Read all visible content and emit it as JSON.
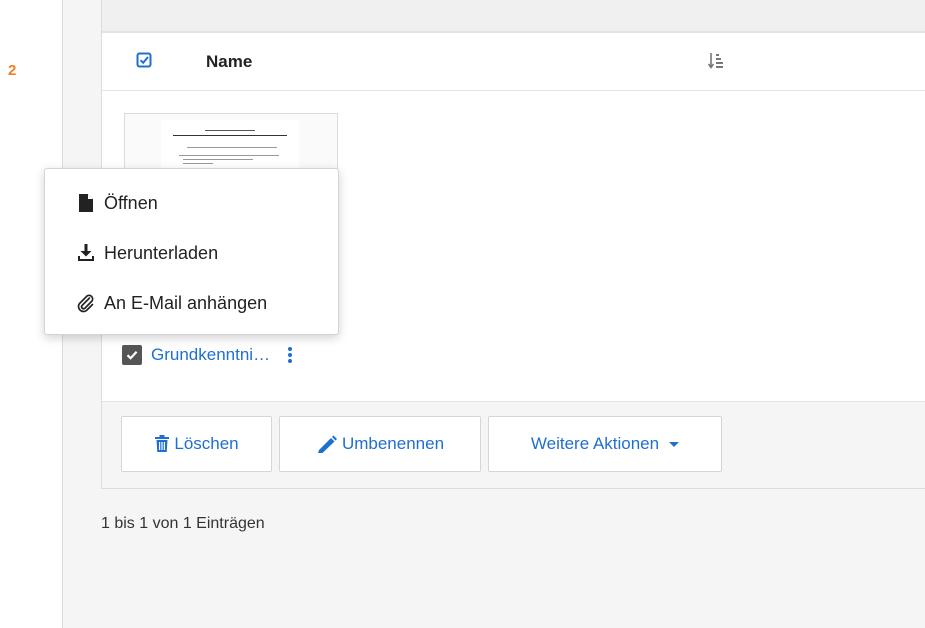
{
  "sidebar": {
    "marker": "2"
  },
  "table": {
    "header": {
      "name_label": "Name"
    },
    "rows": [
      {
        "name": "Grundkenntni…",
        "selected": true
      }
    ]
  },
  "context_menu": {
    "items": [
      {
        "label": "Öffnen",
        "icon": "file-icon"
      },
      {
        "label": "Herunterladen",
        "icon": "download-icon"
      },
      {
        "label": "An E-Mail anhängen",
        "icon": "paperclip-icon"
      }
    ]
  },
  "actions": {
    "delete_label": "Löschen",
    "rename_label": "Umbenennen",
    "more_label": "Weitere Aktionen"
  },
  "pager": {
    "info": "1 bis 1 von 1 Einträgen"
  },
  "colors": {
    "link": "#1f6fd1",
    "accent": "#f47b20"
  }
}
